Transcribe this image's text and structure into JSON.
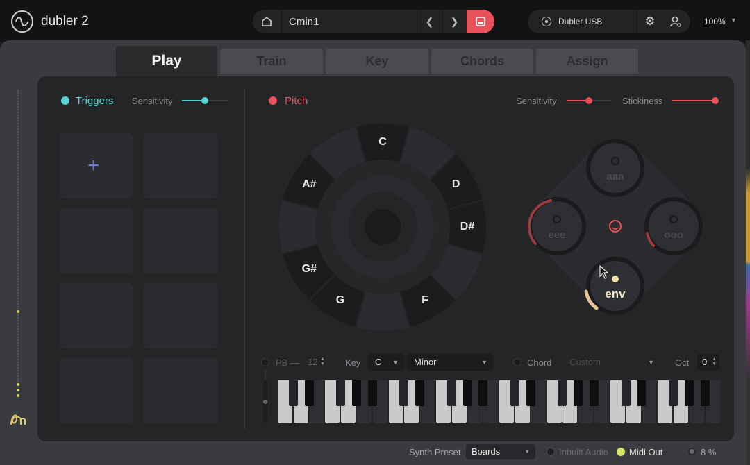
{
  "app": {
    "name": "dubler 2",
    "zoom": "100%"
  },
  "preset": {
    "name": "Cmin1"
  },
  "device": {
    "name": "Dubler USB"
  },
  "tabs": [
    {
      "label": "Play",
      "active": true
    },
    {
      "label": "Train",
      "active": false
    },
    {
      "label": "Key",
      "active": false
    },
    {
      "label": "Chords",
      "active": false
    },
    {
      "label": "Assign",
      "active": false
    }
  ],
  "triggers": {
    "label": "Triggers",
    "sensitivity_label": "Sensitivity",
    "sensitivity": 0.5,
    "color": "#58d3d1",
    "pads": [
      {
        "label": "+"
      },
      {
        "label": ""
      },
      {
        "label": ""
      },
      {
        "label": ""
      },
      {
        "label": ""
      },
      {
        "label": ""
      },
      {
        "label": ""
      },
      {
        "label": ""
      }
    ]
  },
  "pitch": {
    "label": "Pitch",
    "color": "#e8505b",
    "sensitivity_label": "Sensitivity",
    "sensitivity": 0.5,
    "stickiness_label": "Stickiness",
    "stickiness": 1.0,
    "notes": [
      "C",
      "D",
      "D#",
      "F",
      "G",
      "G#",
      "A#"
    ]
  },
  "vowels": {
    "top": "aaa",
    "left": "eee",
    "right": "ooo",
    "bottom": "env"
  },
  "controls": {
    "pb_label": "PB",
    "pb_dash": "—",
    "pb_value": "12",
    "key_label": "Key",
    "key_value": "C",
    "scale_value": "Minor",
    "chord_label": "Chord",
    "chord_value": "Custom",
    "oct_label": "Oct",
    "oct_value": "0"
  },
  "status": {
    "synth_preset_label": "Synth Preset",
    "synth_preset_value": "Boards",
    "inbuilt_audio_label": "Inbuilt Audio",
    "midi_out_label": "Midi Out",
    "midi_out_color": "#d6e36a",
    "cpu_value": "8 %"
  }
}
